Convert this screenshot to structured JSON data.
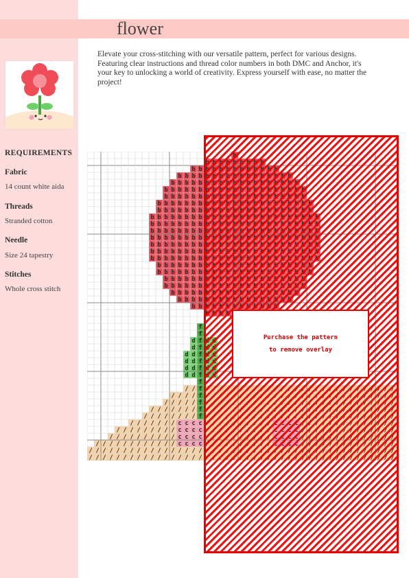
{
  "pattern": {
    "title": "flower",
    "description": "Elevate your cross-stitching with our versatile pattern, perfect for various designs. Featuring clear instructions and thread color numbers in both DMC and Anchor, it's your key to unlocking a world of creativity. Express yourself with ease, no matter the project!"
  },
  "requirements": {
    "heading": "REQUIREMENTS",
    "items": [
      {
        "label": "Fabric",
        "value": "14 count white aida"
      },
      {
        "label": "Threads",
        "value": "Stranded cotton"
      },
      {
        "label": "Needle",
        "value": "Size 24 tapestry"
      },
      {
        "label": "Stitches",
        "value": "Whole cross stitch"
      }
    ]
  },
  "overlay": {
    "line1": "Purchase the pattern",
    "line2": "to remove overlay"
  },
  "legend_symbols": {
    "flower": "b",
    "leaf": "d",
    "stem": "f",
    "cheek": "c",
    "ground": "/"
  },
  "colors": {
    "flower": "#ea4a55",
    "leaf": "#6fcf6a",
    "stem": "#4aa845",
    "cheek": "#f2a2b4",
    "ground": "#f6d3a8",
    "overlay": "#e80000",
    "sidebar": "#fcdcdc",
    "title_bar": "#fdcac6"
  }
}
